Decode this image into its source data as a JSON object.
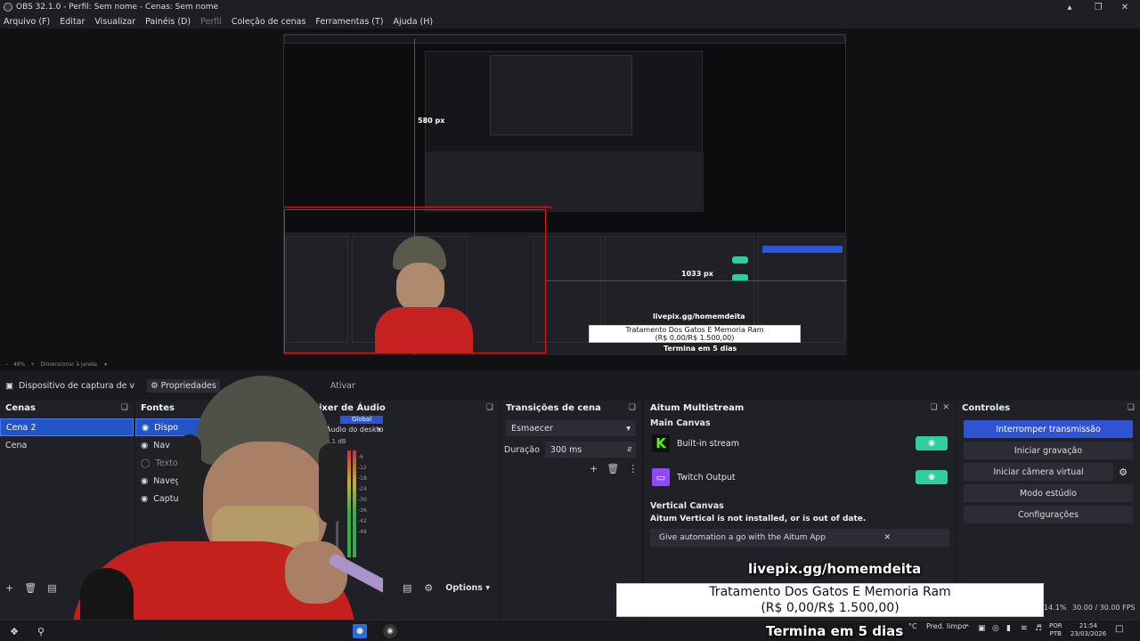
{
  "window": {
    "title": "OBS 32.1.0 - Perfil: Sem nome - Cenas: Sem nome"
  },
  "menu": [
    {
      "label": "Arquivo (F)",
      "disabled": false
    },
    {
      "label": "Editar",
      "disabled": false
    },
    {
      "label": "Visualizar",
      "disabled": false
    },
    {
      "label": "Painéis (D)",
      "disabled": false
    },
    {
      "label": "Perfil",
      "disabled": true
    },
    {
      "label": "Coleção de cenas",
      "disabled": false
    },
    {
      "label": "Ferramentas (T)",
      "disabled": false
    },
    {
      "label": "Ajuda (H)",
      "disabled": false
    }
  ],
  "preview": {
    "measure_height": "580 px",
    "measure_width": "1033 px",
    "zoom": "48%",
    "scale_mode": "Dimensionar à janela"
  },
  "source_toolbar": {
    "source_name": "Dispositivo de captura de v",
    "properties_label": "Propriedades",
    "activate_label": "Ativar"
  },
  "scenes": {
    "title": "Cenas",
    "items": [
      "Cena 2",
      "Cena"
    ],
    "selected": 0
  },
  "sources": {
    "title": "Fontes",
    "items": [
      "Dispo",
      "Nav",
      "Texto",
      "Navegado",
      "Captura de"
    ]
  },
  "mixer": {
    "title": "Mixer de Áudio",
    "tab_global": "Global",
    "channel": "Áudio do deskto",
    "db_value": "5.1 dB",
    "scale": [
      "-6",
      "-12",
      "-18",
      "-24",
      "-30",
      "-36",
      "-42",
      "-48"
    ]
  },
  "transitions": {
    "title": "Transições de cena",
    "type": "Esmaecer",
    "duration_label": "Duração",
    "duration_value": "300 ms"
  },
  "multistream": {
    "title": "Aitum Multistream",
    "main_canvas": "Main Canvas",
    "outputs": [
      {
        "name": "Built-in stream",
        "icon": "kick-icon",
        "color": "#53fc18"
      },
      {
        "name": "Twitch Output",
        "icon": "twitch-icon",
        "color": "#9146ff"
      }
    ],
    "vertical_canvas": "Vertical Canvas",
    "vertical_warning": "Aitum Vertical is not installed, or is out of date.",
    "give_automation": "Give automation a go with the Aitum App",
    "options_label": "Options"
  },
  "controls": {
    "title": "Controles",
    "buttons": [
      "Interromper transmissão",
      "Iniciar gravação",
      "Iniciar câmera virtual",
      "Modo estúdio",
      "Configurações"
    ]
  },
  "overlay": {
    "pix": "livepix.gg/homemdeita",
    "goal_title": "Tratamento Dos Gatos E Memoria Ram",
    "goal_amount": "(R$ 0,00/R$ 1.500,00)",
    "ends": "Termina em 5 dias"
  },
  "statusbar": {
    "cpu": "14.1%",
    "fps": "30.00 / 30.00 FPS"
  },
  "taskbar": {
    "weather_temp": "°C",
    "weather_desc": "Pred. limpo",
    "lang_top": "POR",
    "lang_bottom": "PTB",
    "time": "21:54",
    "date": "23/03/2026"
  },
  "colors": {
    "accent": "#2e54d4",
    "live_toggle": "#2ecf9b",
    "guide_red": "#e01a1a"
  }
}
